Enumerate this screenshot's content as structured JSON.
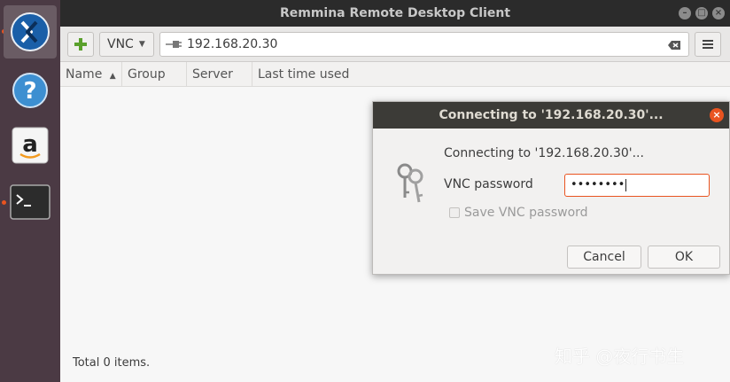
{
  "window": {
    "title": "Remmina Remote Desktop Client",
    "minimize_glyph": "–",
    "maximize_glyph": "□",
    "close_glyph": "×"
  },
  "launcher": {
    "items": [
      {
        "icon": "remmina-icon",
        "running": true,
        "active": true
      },
      {
        "icon": "help-icon",
        "running": false
      },
      {
        "icon": "amazon-icon",
        "running": false
      },
      {
        "icon": "terminal-icon",
        "running": true
      }
    ]
  },
  "toolbar": {
    "add_icon": "plus-icon",
    "protocol": "VNC",
    "search_value": "192.168.20.30",
    "menu_icon": "hamburger-icon"
  },
  "columns": {
    "name": "Name",
    "group": "Group",
    "server": "Server",
    "last_used": "Last time used"
  },
  "status": {
    "total": "Total 0 items."
  },
  "dialog": {
    "title": "Connecting to '192.168.20.30'...",
    "message": "Connecting to '192.168.20.30'...",
    "password_label": "VNC password",
    "password_value": "••••••••",
    "save_label": "Save VNC password",
    "cancel_label": "Cancel",
    "ok_label": "OK",
    "close_glyph": "×"
  },
  "watermark": "知乎 @夜行书生",
  "colors": {
    "launcher_bg": "#4b3a44",
    "accent": "#e95420",
    "titlebar_bg": "#2b2b2b",
    "dialog_title_bg": "#3c3b37"
  }
}
